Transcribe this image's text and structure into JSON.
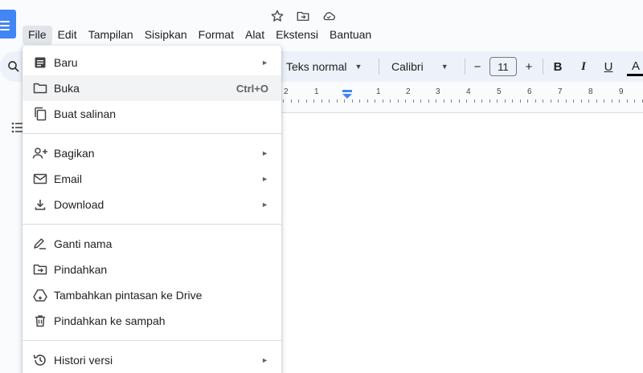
{
  "menubar": {
    "items": [
      "File",
      "Edit",
      "Tampilan",
      "Sisipkan",
      "Format",
      "Alat",
      "Ekstensi",
      "Bantuan"
    ]
  },
  "toolbar": {
    "style": "Teks normal",
    "font": "Calibri",
    "font_size": "11",
    "minus": "−",
    "plus": "+",
    "bold": "B",
    "italic": "I",
    "underline": "U",
    "text_color": "A"
  },
  "ruler": {
    "numbers": [
      "2",
      "1",
      "1",
      "2",
      "3",
      "4",
      "5",
      "6",
      "7",
      "8",
      "9"
    ]
  },
  "file_menu": {
    "groups": [
      [
        {
          "icon": "new-doc-icon",
          "label": "Baru",
          "submenu": true
        },
        {
          "icon": "folder-open-icon",
          "label": "Buka",
          "shortcut": "Ctrl+O",
          "hover": true
        },
        {
          "icon": "copy-icon",
          "label": "Buat salinan"
        }
      ],
      [
        {
          "icon": "share-person-icon",
          "label": "Bagikan",
          "submenu": true
        },
        {
          "icon": "email-icon",
          "label": "Email",
          "submenu": true
        },
        {
          "icon": "download-icon",
          "label": "Download",
          "submenu": true
        }
      ],
      [
        {
          "icon": "rename-icon",
          "label": "Ganti nama"
        },
        {
          "icon": "move-folder-icon",
          "label": "Pindahkan"
        },
        {
          "icon": "drive-shortcut-icon",
          "label": "Tambahkan pintasan ke Drive"
        },
        {
          "icon": "trash-icon",
          "label": "Pindahkan ke sampah"
        }
      ],
      [
        {
          "icon": "version-history-icon",
          "label": "Histori versi",
          "submenu": true
        }
      ]
    ]
  },
  "colors": {
    "accent": "#4285f4",
    "toolbar_bg": "#edf2fa",
    "hover_bg": "#f1f3f4"
  }
}
